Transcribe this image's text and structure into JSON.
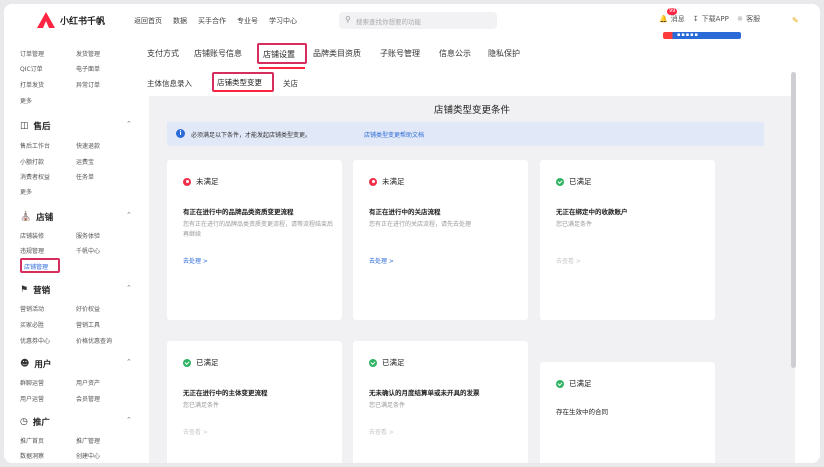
{
  "topbar": {
    "brand": "小红书千帆",
    "nav": [
      "返回首页",
      "数据",
      "买手合作",
      "专业号",
      "学习中心"
    ],
    "search_placeholder": "搜索查找你想要的功能",
    "badge": "99",
    "tools": [
      "消息",
      "下载APP",
      "客服"
    ]
  },
  "sidebar": {
    "top_rows": [
      [
        "订单管理",
        "发货管理"
      ],
      [
        "QIC订单",
        "电子面单"
      ],
      [
        "打单发货",
        "异常订单"
      ],
      [
        "更多",
        ""
      ]
    ],
    "sections": [
      {
        "title": "售后",
        "icon": "refund-icon",
        "rows": [
          [
            "售后工作台",
            "快速退款"
          ],
          [
            "小额打款",
            "运费宝"
          ],
          [
            "消费者权益",
            "任务单"
          ],
          [
            "更多",
            ""
          ]
        ]
      },
      {
        "title": "店铺",
        "icon": "store-icon",
        "rows": [
          [
            "店铺装修",
            "服务体验"
          ],
          [
            "违规管理",
            "千帆中心"
          ],
          [
            "店铺管理",
            ""
          ]
        ]
      },
      {
        "title": "营销",
        "icon": "marketing-icon",
        "rows": [
          [
            "营销活动",
            "好价权益"
          ],
          [
            "买家必胜",
            "营销工具"
          ],
          [
            "优惠券中心",
            "价格优惠查询"
          ]
        ]
      },
      {
        "title": "用户",
        "icon": "users-icon",
        "rows": [
          [
            "群聊运营",
            "用户资产"
          ],
          [
            "用户运营",
            "会员管理"
          ]
        ]
      },
      {
        "title": "推广",
        "icon": "promotion-icon",
        "rows": [
          [
            "推广首页",
            "推广管理"
          ],
          [
            "数据洞察",
            "创建中心"
          ]
        ]
      }
    ],
    "active_item": "店铺管理"
  },
  "main": {
    "tabs": [
      "支付方式",
      "店铺账号信息",
      "店铺设置",
      "品牌类目资质",
      "子账号管理",
      "信息公示",
      "隐私保护"
    ],
    "active_tab": "店铺设置",
    "subtabs": [
      "主体信息录入",
      "店铺类型变更",
      "关店"
    ],
    "active_subtab": "店铺类型变更",
    "content_title": "店铺类型变更条件",
    "notice_text": "必须满足以下条件，才能发起店铺类型变更。",
    "notice_link": "店铺类型变更帮助文档",
    "cards": [
      {
        "status": "未满足",
        "ok": false,
        "title": "有正在进行中的品牌品类资质变更流程",
        "desc": "您有正在进行的品牌品类资质变更流程，请等流程结束后再继续",
        "action": "去处理 >"
      },
      {
        "status": "未满足",
        "ok": false,
        "title": "有正在进行中的关店流程",
        "desc": "您有正在进行的关店流程，请先去处理",
        "action": "去处理 >"
      },
      {
        "status": "已满足",
        "ok": true,
        "title": "无正在绑定中的收款账户",
        "desc": "您已满足条件",
        "action": "去查看 >"
      },
      {
        "status": "已满足",
        "ok": true,
        "title": "无正在进行中的主体变更流程",
        "desc": "您已满足条件",
        "action": "去查看 >"
      },
      {
        "status": "已满足",
        "ok": true,
        "title": "无未确认的月度结算单或未开具的发票",
        "desc": "您已满足条件",
        "action": "去查看 >"
      },
      {
        "status": "已满足",
        "ok": true,
        "title": "存在生效中的合同",
        "desc": "",
        "action": ""
      }
    ]
  },
  "colors": {
    "accent": "#ff2442",
    "link": "#2b6bd8",
    "ok": "#2fb463",
    "bad": "#f0304a"
  }
}
